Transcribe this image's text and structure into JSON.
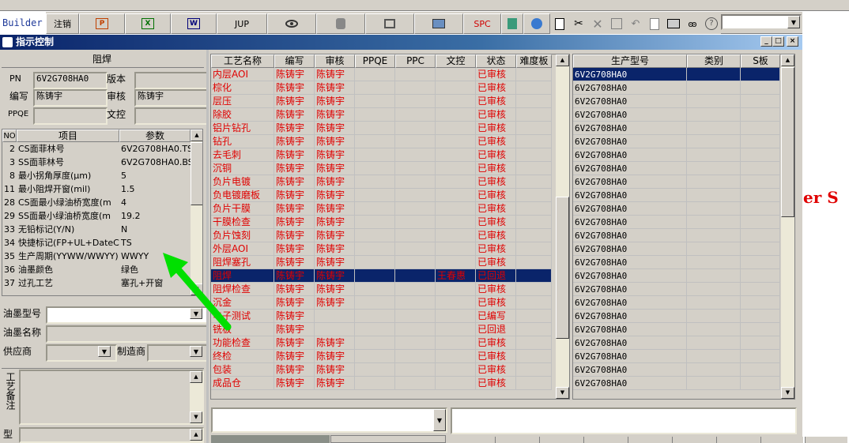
{
  "toolbar": {
    "builder_label": "Builder",
    "logout_label": "注销",
    "jup_label": "JUP",
    "spc_label": "SPC",
    "word_label": "W",
    "excel_label": "X",
    "ppt_label": "P"
  },
  "window": {
    "title": "指示控制",
    "min_label": "_",
    "max_label": "□",
    "close_label": "×"
  },
  "background_text": "er S",
  "header": {
    "panel_title": "阻焊",
    "pn_label": "PN",
    "pn_value": "6V2G708HA0",
    "version_label": "版本",
    "version_value": "",
    "author_label": "编写",
    "author_value": "陈铸宇",
    "review_label": "审核",
    "review_value": "陈铸宇",
    "ppqe_label": "PPQE",
    "ppqe_value": "",
    "doc_control_label": "文控",
    "doc_control_value": ""
  },
  "params": {
    "columns": [
      "NO",
      "项目",
      "参数"
    ],
    "rows": [
      {
        "no": "2",
        "item": "CS面菲林号",
        "value": "6V2G708HA0.TS"
      },
      {
        "no": "3",
        "item": "SS面菲林号",
        "value": "6V2G708HA0.BS"
      },
      {
        "no": "8",
        "item": "最小拐角厚度(μm)",
        "value": "5"
      },
      {
        "no": "11",
        "item": "最小阻焊开窗(mil)",
        "value": "1.5"
      },
      {
        "no": "28",
        "item": "CS面最小绿油桥宽度(m",
        "value": "4"
      },
      {
        "no": "29",
        "item": "SS面最小绿油桥宽度(m",
        "value": "19.2"
      },
      {
        "no": "33",
        "item": "无铅标记(Y/N)",
        "value": "N"
      },
      {
        "no": "34",
        "item": "快捷标记(FP+UL+DateCo",
        "value": "TS"
      },
      {
        "no": "35",
        "item": "生产周期(YYWW/WWYY)",
        "value": "WWYY"
      },
      {
        "no": "36",
        "item": "油墨颜色",
        "value": "绿色"
      },
      {
        "no": "37",
        "item": "过孔工艺",
        "value": "塞孔+开窗"
      }
    ]
  },
  "ink": {
    "type_label": "油墨型号",
    "type_value": "",
    "name_label": "油墨名称",
    "name_value": "",
    "supplier_label": "供应商",
    "supplier_value": "",
    "maker_label": "制造商",
    "maker_value": "",
    "process_note_label": "工艺备注",
    "bottom_label": "型"
  },
  "process": {
    "columns": [
      "工艺名称",
      "编写",
      "审核",
      "PPQE",
      "PPC",
      "文控",
      "状态",
      "难度板"
    ],
    "rows": [
      {
        "name": "内层AOI",
        "author": "陈铸宇",
        "review": "陈铸宇",
        "ppqe": "",
        "ppc": "",
        "doc": "",
        "status": "已审核",
        "difficult": ""
      },
      {
        "name": "棕化",
        "author": "陈铸宇",
        "review": "陈铸宇",
        "ppqe": "",
        "ppc": "",
        "doc": "",
        "status": "已审核",
        "difficult": ""
      },
      {
        "name": "层压",
        "author": "陈铸宇",
        "review": "陈铸宇",
        "ppqe": "",
        "ppc": "",
        "doc": "",
        "status": "已审核",
        "difficult": ""
      },
      {
        "name": "除胶",
        "author": "陈铸宇",
        "review": "陈铸宇",
        "ppqe": "",
        "ppc": "",
        "doc": "",
        "status": "已审核",
        "difficult": ""
      },
      {
        "name": "铝片钻孔",
        "author": "陈铸宇",
        "review": "陈铸宇",
        "ppqe": "",
        "ppc": "",
        "doc": "",
        "status": "已审核",
        "difficult": ""
      },
      {
        "name": "钻孔",
        "author": "陈铸宇",
        "review": "陈铸宇",
        "ppqe": "",
        "ppc": "",
        "doc": "",
        "status": "已审核",
        "difficult": ""
      },
      {
        "name": "去毛刺",
        "author": "陈铸宇",
        "review": "陈铸宇",
        "ppqe": "",
        "ppc": "",
        "doc": "",
        "status": "已审核",
        "difficult": ""
      },
      {
        "name": "沉铜",
        "author": "陈铸宇",
        "review": "陈铸宇",
        "ppqe": "",
        "ppc": "",
        "doc": "",
        "status": "已审核",
        "difficult": ""
      },
      {
        "name": "负片电镀",
        "author": "陈铸宇",
        "review": "陈铸宇",
        "ppqe": "",
        "ppc": "",
        "doc": "",
        "status": "已审核",
        "difficult": ""
      },
      {
        "name": "负电镀磨板",
        "author": "陈铸宇",
        "review": "陈铸宇",
        "ppqe": "",
        "ppc": "",
        "doc": "",
        "status": "已审核",
        "difficult": ""
      },
      {
        "name": "负片干膜",
        "author": "陈铸宇",
        "review": "陈铸宇",
        "ppqe": "",
        "ppc": "",
        "doc": "",
        "status": "已审核",
        "difficult": ""
      },
      {
        "name": "干膜检查",
        "author": "陈铸宇",
        "review": "陈铸宇",
        "ppqe": "",
        "ppc": "",
        "doc": "",
        "status": "已审核",
        "difficult": ""
      },
      {
        "name": "负片蚀刻",
        "author": "陈铸宇",
        "review": "陈铸宇",
        "ppqe": "",
        "ppc": "",
        "doc": "",
        "status": "已审核",
        "difficult": ""
      },
      {
        "name": "外层AOI",
        "author": "陈铸宇",
        "review": "陈铸宇",
        "ppqe": "",
        "ppc": "",
        "doc": "",
        "status": "已审核",
        "difficult": ""
      },
      {
        "name": "阻焊塞孔",
        "author": "陈铸宇",
        "review": "陈铸宇",
        "ppqe": "",
        "ppc": "",
        "doc": "",
        "status": "已审核",
        "difficult": ""
      },
      {
        "name": "阻焊",
        "author": "陈铸宇",
        "review": "陈铸宇",
        "ppqe": "",
        "ppc": "",
        "doc": "王春惠",
        "status": "已回退",
        "difficult": ""
      },
      {
        "name": "阻焊检查",
        "author": "陈铸宇",
        "review": "陈铸宇",
        "ppqe": "",
        "ppc": "",
        "doc": "",
        "status": "已审核",
        "difficult": ""
      },
      {
        "name": "沉金",
        "author": "陈铸宇",
        "review": "陈铸宇",
        "ppqe": "",
        "ppc": "",
        "doc": "",
        "status": "已审核",
        "difficult": ""
      },
      {
        "name": "电子测试",
        "author": "陈铸宇",
        "review": "",
        "ppqe": "",
        "ppc": "",
        "doc": "",
        "status": "已编写",
        "difficult": ""
      },
      {
        "name": "铣板",
        "author": "陈铸宇",
        "review": "",
        "ppqe": "",
        "ppc": "",
        "doc": "",
        "status": "已回退",
        "difficult": ""
      },
      {
        "name": "功能检查",
        "author": "陈铸宇",
        "review": "陈铸宇",
        "ppqe": "",
        "ppc": "",
        "doc": "",
        "status": "已审核",
        "difficult": ""
      },
      {
        "name": "终检",
        "author": "陈铸宇",
        "review": "陈铸宇",
        "ppqe": "",
        "ppc": "",
        "doc": "",
        "status": "已审核",
        "difficult": ""
      },
      {
        "name": "包装",
        "author": "陈铸宇",
        "review": "陈铸宇",
        "ppqe": "",
        "ppc": "",
        "doc": "",
        "status": "已审核",
        "difficult": ""
      },
      {
        "name": "成品仓",
        "author": "陈铸宇",
        "review": "陈铸宇",
        "ppqe": "",
        "ppc": "",
        "doc": "",
        "status": "已审核",
        "difficult": ""
      }
    ],
    "selected_index": 15
  },
  "models": {
    "columns": [
      "生产型号",
      "类别",
      "S板"
    ],
    "rows": [
      "6V2G708HA0",
      "6V2G708HA0",
      "6V2G708HA0",
      "6V2G708HA0",
      "6V2G708HA0",
      "6V2G708HA0",
      "6V2G708HA0",
      "6V2G708HA0",
      "6V2G708HA0",
      "6V2G708HA0",
      "6V2G708HA0",
      "6V2G708HA0",
      "6V2G708HA0",
      "6V2G708HA0",
      "6V2G708HA0",
      "6V2G708HA0",
      "6V2G708HA0",
      "6V2G708HA0",
      "6V2G708HA0",
      "6V2G708HA0",
      "6V2G708HA0",
      "6V2G708HA0",
      "6V2G708HA0",
      "6V2G708HA0"
    ],
    "selected_index": 0
  },
  "colors": {
    "text_red": "#e00000",
    "selection_bg": "#0a246a",
    "arrow_green": "#00e000"
  },
  "scroll_arrow_up": "▲",
  "scroll_arrow_down": "▼"
}
